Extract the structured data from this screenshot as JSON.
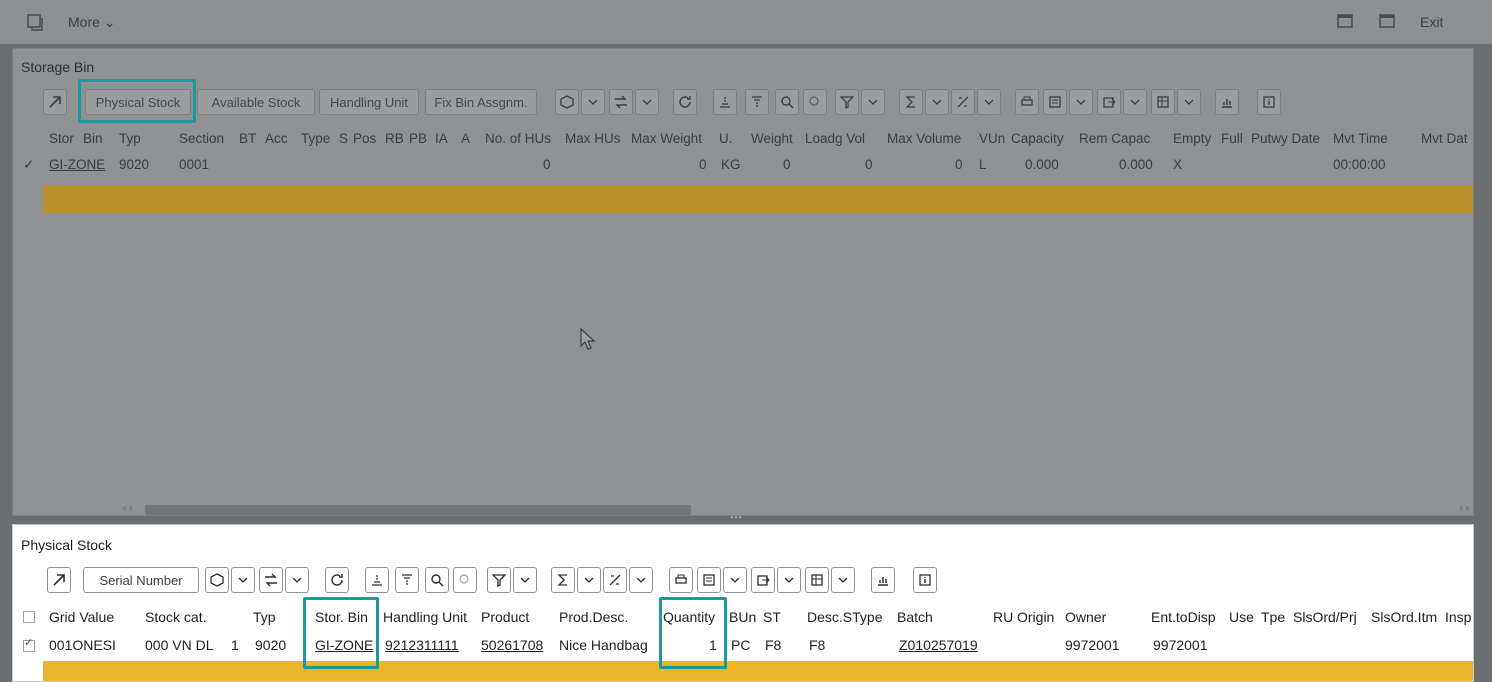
{
  "topbar": {
    "more_label": "More",
    "exit_label": "Exit"
  },
  "storage_bin": {
    "title": "Storage Bin",
    "toolbar": {
      "physical_stock": "Physical Stock",
      "available_stock": "Available Stock",
      "handling_unit": "Handling Unit",
      "fix_bin_assign": "Fix Bin Assgnm."
    },
    "columns": [
      "Stor",
      "Bin",
      "Typ",
      "Section",
      "BT",
      "Acc",
      "Type",
      "S",
      "Pos",
      "RB",
      "PB",
      "IA",
      "A",
      "No. of HUs",
      "Max HUs",
      "Max Weight",
      "U.",
      "Weight",
      "Loadg Vol",
      "Max Volume",
      "VUn",
      "Capacity",
      "Rem Capac",
      "Empty",
      "Full",
      "Putwy Date",
      "Mvt Time",
      "Mvt Dat"
    ],
    "row": {
      "check": "✓",
      "bin": "GI-ZONE",
      "typ": "9020",
      "section": "0001",
      "no_hus": "0",
      "max_weight": "0",
      "unit": "KG",
      "weight": "0",
      "loadg_vol": "0",
      "max_volume": "0",
      "vun": "L",
      "capacity": "0.000",
      "rem_capac": "0.000",
      "empty": "X",
      "mvt_time": "00:00:00"
    }
  },
  "physical_stock": {
    "title": "Physical Stock",
    "toolbar": {
      "serial_number": "Serial Number"
    },
    "columns": {
      "grid_value": "Grid Value",
      "stock_cat": "Stock cat.",
      "typ": "Typ",
      "stor_bin": "Stor. Bin",
      "handling_unit": "Handling Unit",
      "product": "Product",
      "prod_desc": "Prod.Desc.",
      "quantity": "Quantity",
      "bun": "BUn",
      "st": "ST",
      "desc_stype": "Desc.SType",
      "batch": "Batch",
      "ru": "RU",
      "origin": "Origin",
      "owner": "Owner",
      "ent_to_disp": "Ent.toDisp",
      "use": "Use",
      "tpe": "Tpe",
      "slsord_prj": "SlsOrd/Prj",
      "slsord_itm": "SlsOrd.Itm",
      "insp": "Insp"
    },
    "row": {
      "check": "✓",
      "grid_value": "001ONESI",
      "stock_cat": "000 VN DL",
      "stock_cat_num": "1",
      "typ": "9020",
      "stor_bin": "GI-ZONE",
      "handling_unit": "9212311111",
      "product": "50261708",
      "prod_desc": "Nice Handbag",
      "quantity": "1",
      "bun": "PC",
      "st": "F8",
      "desc_stype": "F8",
      "batch": "Z010257019",
      "owner": "9972001",
      "ent_to_disp": "9972001"
    }
  }
}
